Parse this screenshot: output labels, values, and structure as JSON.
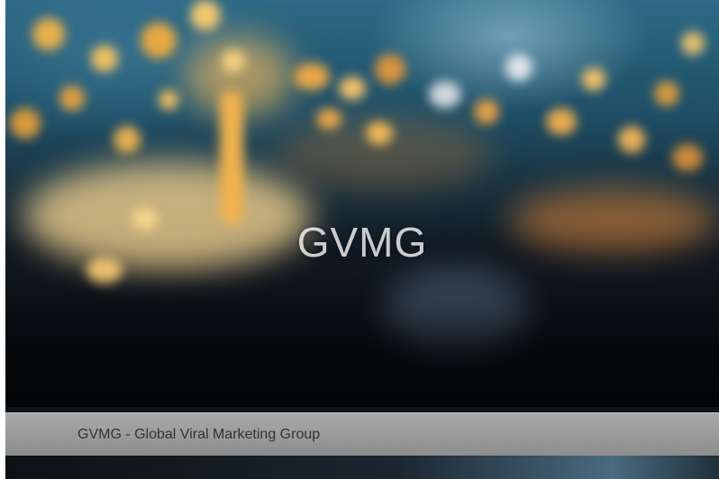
{
  "hero": {
    "title": "GVMG"
  },
  "caption": {
    "text": "GVMG - Global Viral Marketing Group"
  }
}
